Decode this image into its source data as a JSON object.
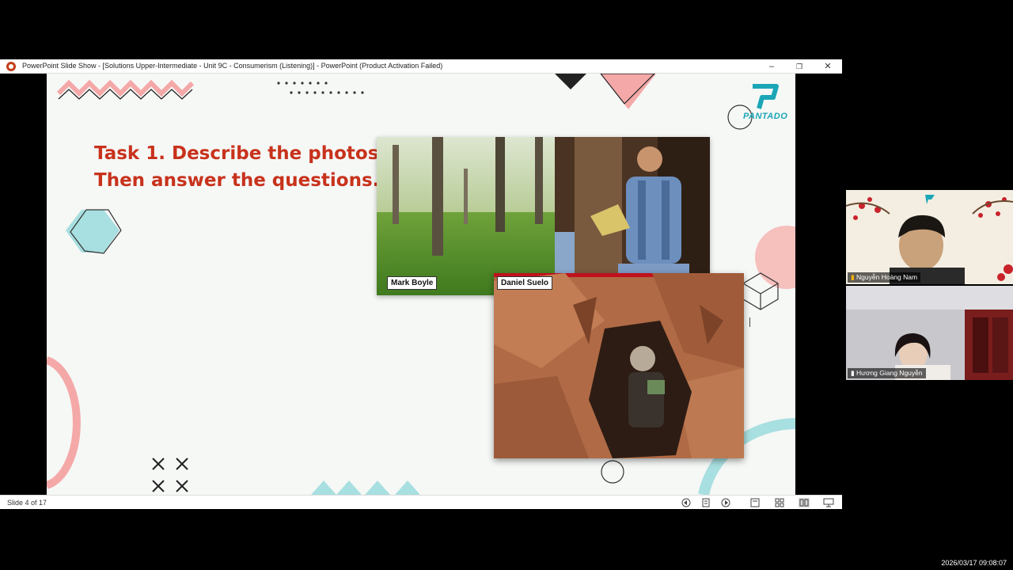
{
  "window": {
    "title": "PowerPoint Slide Show - [Solutions Upper-Intermediate - Unit 9C - Consumerism (Listening)] - PowerPoint (Product Activation Failed)",
    "minimize": "–",
    "restore": "❐",
    "close": "✕"
  },
  "slide": {
    "title_line1": "Task 1. Describe the photos.",
    "title_line2": "Then answer the questions.",
    "logo_text": "PANTADO",
    "photo1_label": "Mark Boyle",
    "photo2_label": "Daniel Suelo"
  },
  "statusbar": {
    "slide_indicator": "Slide 4 of 17",
    "icons": [
      "prev-icon",
      "notes-icon",
      "next-icon",
      "normal-view-icon",
      "slide-sorter-icon",
      "reading-view-icon",
      "slideshow-icon"
    ]
  },
  "video": {
    "participant1": "Nguyễn Hoàng Nam",
    "participant2": "Hương Giang Nguyễn"
  },
  "clock": "2026/03/17 09:08:07",
  "colors": {
    "title_red": "#c8321c",
    "logo_teal": "#1aa6b7",
    "pink": "#f4a9a8",
    "teal_light": "#a8dfe0"
  }
}
